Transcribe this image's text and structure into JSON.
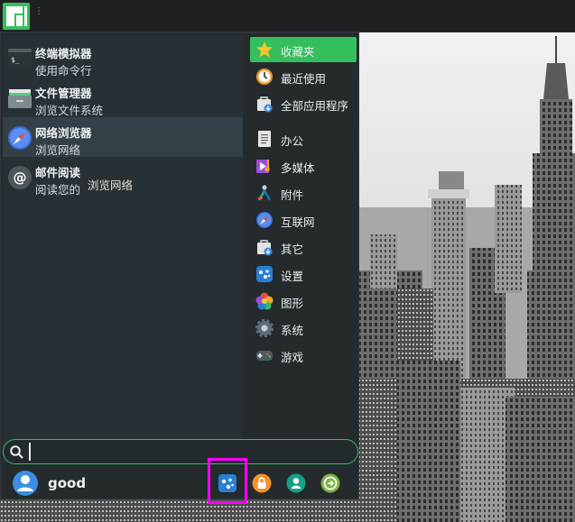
{
  "user": {
    "name": "good"
  },
  "search": {
    "value": ""
  },
  "applications": [
    {
      "name": "终端模拟器",
      "description": "使用命令行",
      "icon": "terminal-icon"
    },
    {
      "name": "文件管理器",
      "description": "浏览文件系统",
      "icon": "file-manager-icon"
    },
    {
      "name": "网络浏览器",
      "description": "浏览网络",
      "icon": "web-browser-icon"
    },
    {
      "name": "邮件阅读",
      "description": "阅读您的",
      "icon": "mail-icon"
    }
  ],
  "tooltip": {
    "text": "浏览网络"
  },
  "categories": [
    {
      "label": "收藏夹",
      "icon": "star-icon"
    },
    {
      "label": "最近使用",
      "icon": "clock-icon"
    },
    {
      "label": "全部应用程序",
      "icon": "all-apps-icon"
    },
    {
      "label": "办公",
      "icon": "office-icon"
    },
    {
      "label": "多媒体",
      "icon": "multimedia-icon"
    },
    {
      "label": "附件",
      "icon": "accessories-icon"
    },
    {
      "label": "互联网",
      "icon": "internet-icon"
    },
    {
      "label": "其它",
      "icon": "other-icon"
    },
    {
      "label": "设置",
      "icon": "settings-icon"
    },
    {
      "label": "图形",
      "icon": "graphics-icon"
    },
    {
      "label": "系统",
      "icon": "system-icon"
    },
    {
      "label": "游戏",
      "icon": "games-icon"
    }
  ],
  "actions": [
    {
      "icon": "settings-manager-icon"
    },
    {
      "icon": "lock-screen-icon"
    },
    {
      "icon": "switch-user-icon"
    },
    {
      "icon": "log-out-icon"
    }
  ],
  "colors": {
    "accent": "#35bf5c",
    "highlight": "#ff00ff",
    "panel": "#252a2d"
  }
}
